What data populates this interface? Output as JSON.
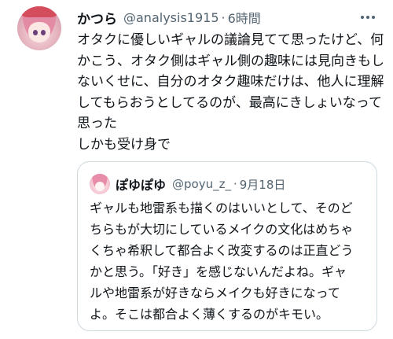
{
  "tweet": {
    "author_name": "かつら",
    "author_handle": "@analysis1915",
    "separator": "·",
    "time": "6時間",
    "body_lines": [
      "オタクに優しいギャルの議論見てて思ったけど、何",
      "かこう、オタク側はギャル側の趣味には見向きもし",
      "ないくせに、自分のオタク趣味だけは、他人に理解",
      "してもらおうとしてるのが、最高にきしょいなって",
      "思った",
      "しかも受け身で"
    ]
  },
  "quoted_tweet": {
    "author_name": "ぽゆぽゆ",
    "author_handle": "@poyu_z_",
    "separator": "·",
    "date": "9月18日",
    "body_lines": [
      "ギャルも地雷系も描くのはいいとして、そのど",
      "ちらもが大切にしているメイクの文化はめちゃ",
      "くちゃ希釈して都合よく改変するのは正直どう",
      "かと思う。「好き」を感じないんだよね。ギャ",
      "ルや地雷系が好きならメイクも好きになって",
      "よ。そこは都合よく薄くするのがキモい。"
    ]
  },
  "icons": {
    "more": "more-horizontal-icon"
  },
  "colors": {
    "text_primary": "#0f1419",
    "text_secondary": "#536471",
    "border": "#cfd9de",
    "background": "#ffffff"
  }
}
